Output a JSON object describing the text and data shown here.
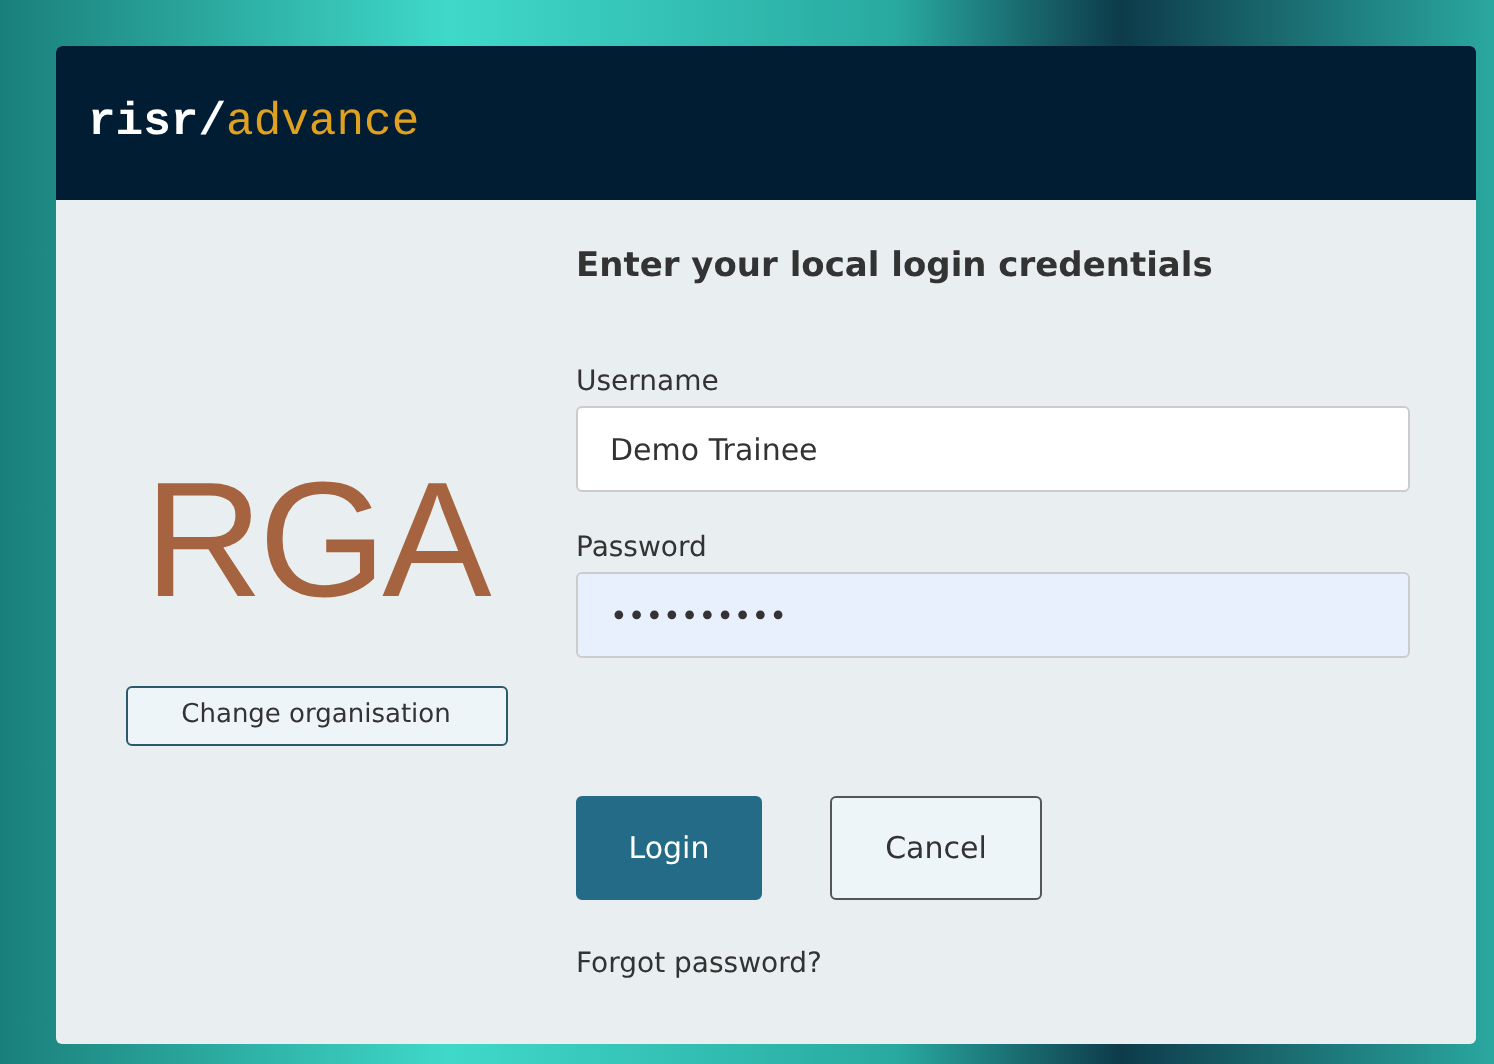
{
  "logo": {
    "prefix": "risr/",
    "suffix": "advance"
  },
  "organisation": {
    "name": "RGA",
    "change_button": "Change organisation"
  },
  "form": {
    "heading": "Enter your local login credentials",
    "fields": [
      {
        "label": "Username",
        "value": "Demo Trainee",
        "kind": "text"
      },
      {
        "label": "Password",
        "value": "••••••••••",
        "kind": "password"
      }
    ],
    "buttons": [
      {
        "label": "Login",
        "kind": "primary"
      },
      {
        "label": "Cancel",
        "kind": "secondary"
      }
    ],
    "forgot_link": "Forgot password?"
  }
}
